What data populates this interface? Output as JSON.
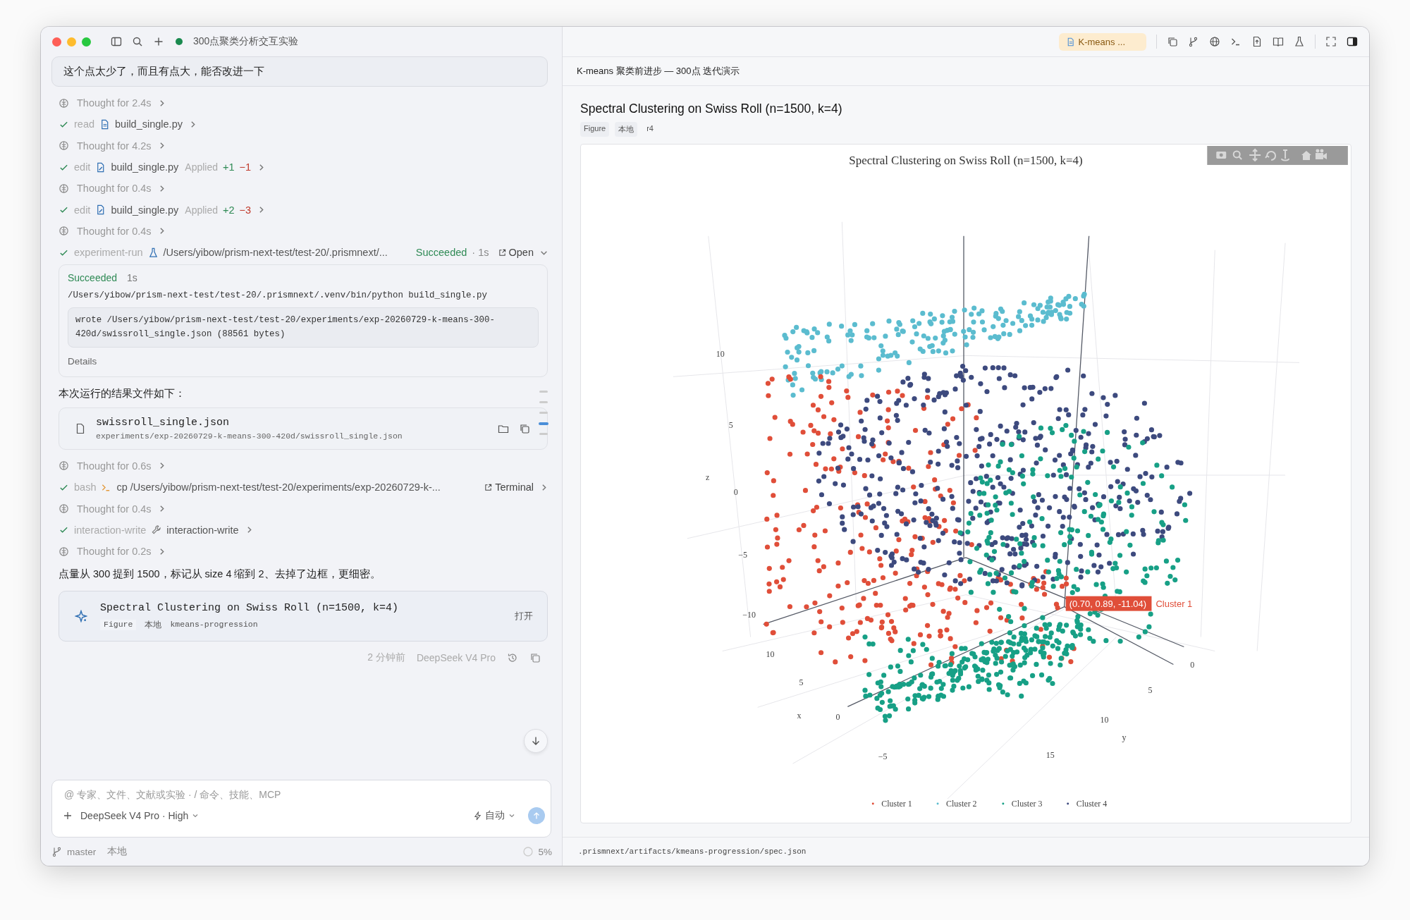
{
  "window": {
    "title": "300点聚类分析交互实验"
  },
  "chat": {
    "user_message": "这个点太少了，而且有点大，能否改进一下",
    "steps": [
      {
        "kind": "thought",
        "label": "Thought for 2.4s"
      },
      {
        "kind": "tool",
        "done": true,
        "tool": "read",
        "target": "build_single.py"
      },
      {
        "kind": "thought",
        "label": "Thought for 4.2s"
      },
      {
        "kind": "tool",
        "done": true,
        "tool": "edit",
        "target": "build_single.py",
        "status": "Applied",
        "added": "+1",
        "removed": "−1"
      },
      {
        "kind": "thought",
        "label": "Thought for 0.4s"
      },
      {
        "kind": "tool",
        "done": true,
        "tool": "edit",
        "target": "build_single.py",
        "status": "Applied",
        "added": "+2",
        "removed": "−3"
      },
      {
        "kind": "thought",
        "label": "Thought for 0.4s"
      },
      {
        "kind": "tool",
        "done": true,
        "tool": "experiment-run",
        "target": "/Users/yibow/prism-next-test/test-20/.prismnext/...",
        "result": "Succeeded",
        "duration": "· 1s",
        "action": "Open",
        "expanded": true,
        "output": {
          "status": "Succeeded",
          "duration": "1s",
          "command": "/Users/yibow/prism-next-test/test-20/.prismnext/.venv/bin/python build_single.py",
          "log": "wrote /Users/yibow/prism-next-test/test-20/experiments/exp-20260729-k-means-300-420d/swissroll_single.json (88561 bytes)",
          "details": "Details"
        }
      },
      {
        "kind": "text",
        "text": "本次运行的结果文件如下："
      },
      {
        "kind": "file",
        "name": "swissroll_single.json",
        "path": "experiments/exp-20260729-k-means-300-420d/swissroll_single.json"
      },
      {
        "kind": "thought",
        "label": "Thought for 0.6s"
      },
      {
        "kind": "tool",
        "done": true,
        "tool": "bash",
        "target": "cp /Users/yibow/prism-next-test/test-20/experiments/exp-20260729-k-...",
        "action": "Terminal"
      },
      {
        "kind": "thought",
        "label": "Thought for 0.4s"
      },
      {
        "kind": "tool",
        "done": true,
        "tool": "interaction-write",
        "target": "interaction-write"
      },
      {
        "kind": "thought",
        "label": "Thought for 0.2s"
      },
      {
        "kind": "text",
        "text": "点量从 300 提到 1500，标记从 size 4 缩到 2、去掉了边框，更细密。"
      },
      {
        "kind": "figure",
        "title": "Spectral Clustering on Swiss Roll (n=1500, k=4)",
        "tags": [
          "Figure",
          "本地",
          "kmeans-progression"
        ],
        "action": "打开"
      }
    ],
    "meta": {
      "time": "2 分钟前",
      "model": "DeepSeek V4 Pro"
    }
  },
  "composer": {
    "placeholder": "@ 专家、文件、文献或实验 · / 命令、技能、MCP",
    "model": "DeepSeek V4 Pro · High",
    "mode": "自动"
  },
  "status_bar": {
    "branch": "master",
    "location": "本地",
    "progress": "5%"
  },
  "viewer": {
    "tab": "K-means ...",
    "doc_title": "K-means 聚类前进步 — 300点 迭代演示",
    "title": "Spectral Clustering on Swiss Roll (n=1500, k=4)",
    "tags": [
      "Figure",
      "本地",
      "r4"
    ],
    "plot": {
      "title": "Spectral Clustering on Swiss Roll (n=1500, k=4)",
      "z_ticks": [
        "10",
        "5",
        "0",
        "−5",
        "−10"
      ],
      "x_ticks": [
        "10",
        "5",
        "0",
        "−5"
      ],
      "y_ticks": [
        "0",
        "5",
        "10",
        "15"
      ],
      "axis_titles": [
        "z",
        "x",
        "y"
      ],
      "tooltip": {
        "coords": "(0.70, 0.89, -11.04)",
        "label": "Cluster 1"
      },
      "legend": [
        {
          "name": "Cluster 1",
          "color": "#e04e39"
        },
        {
          "name": "Cluster 2",
          "color": "#5bbccf"
        },
        {
          "name": "Cluster 3",
          "color": "#17a086"
        },
        {
          "name": "Cluster 4",
          "color": "#3d4a7e"
        }
      ]
    },
    "footer": ".prismnext/artifacts/kmeans-progression/spec.json"
  }
}
